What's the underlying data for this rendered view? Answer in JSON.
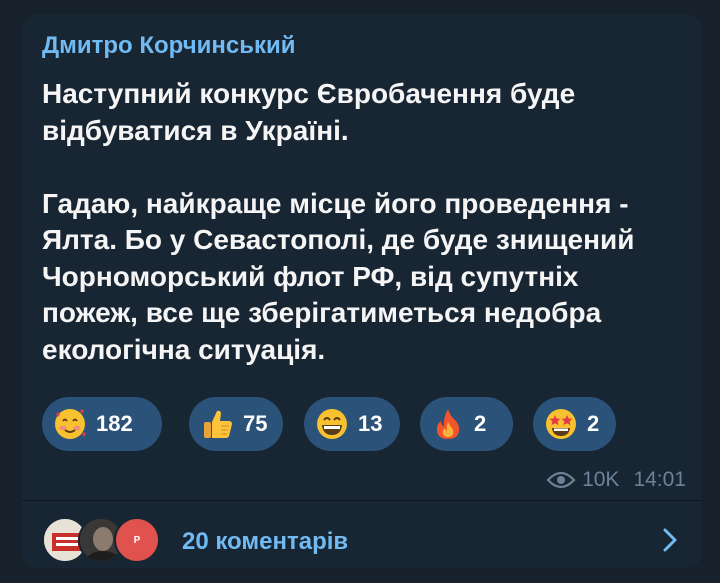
{
  "post": {
    "author": "Дмитро Корчинський",
    "paragraph1": [
      "Наступний конкурс Євробачення буде",
      "відбуватися в Україні."
    ],
    "paragraph2": [
      "Гадаю, найкраще місце його проведення -",
      "Ялта. Бо у Севастополі, де буде знищений",
      "Чорноморський флот РФ, від супутніх",
      "пожеж,  все ще зберігатиметься недобра",
      "екологічна ситуація."
    ]
  },
  "reactions": [
    {
      "icon": "smiling-face-with-hearts-icon",
      "count": "182"
    },
    {
      "icon": "thumbs-up-icon",
      "count": "75"
    },
    {
      "icon": "grinning-face-icon",
      "count": "13"
    },
    {
      "icon": "fire-icon",
      "count": "2"
    },
    {
      "icon": "star-struck-face-icon",
      "count": "2"
    }
  ],
  "meta": {
    "views": "10K",
    "time": "14:01"
  },
  "comments": {
    "label": "20 коментарів",
    "avatar_letter": "P"
  },
  "colors": {
    "background": "#17212b",
    "bubble": "#182533",
    "accent": "#71baf2",
    "reaction_pill": "#2b5278",
    "meta_text": "#6d8197"
  }
}
